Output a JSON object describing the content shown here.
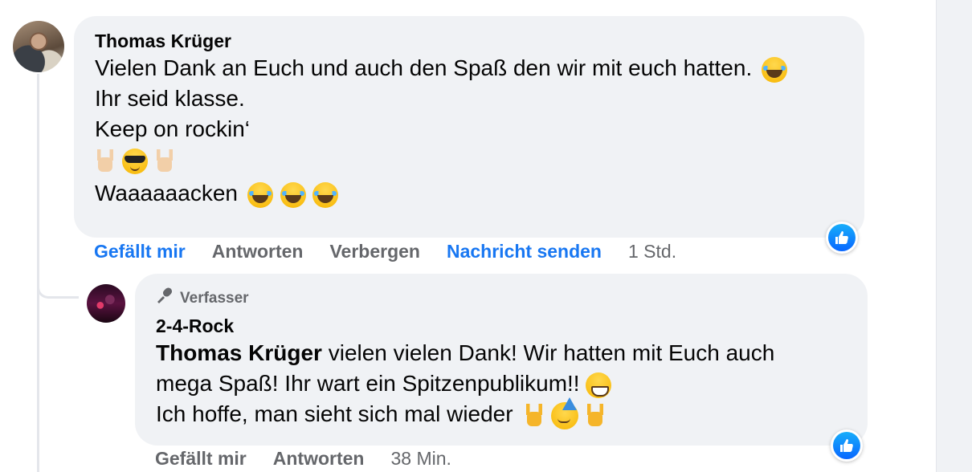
{
  "comment": {
    "author": "Thomas Krüger",
    "lines": [
      "Vielen Dank an Euch und auch den Spaß den wir mit euch hatten.",
      "Ihr seid klasse.",
      "Keep on rockin‘",
      "",
      "Waaaaaacken"
    ],
    "actions": {
      "like": "Gefällt mir",
      "reply": "Antworten",
      "hide": "Verbergen",
      "message": "Nachricht senden",
      "time": "1 Std."
    },
    "reaction": "like"
  },
  "reply": {
    "badge": "Verfasser",
    "author": "2-4-Rock",
    "mention": "Thomas Krüger",
    "line1_rest": " vielen vielen Dank! Wir hatten mit Euch auch",
    "line2": "mega Spaß! Ihr wart ein Spitzenpublikum!!",
    "line3": "Ich hoffe, man sieht sich mal wieder",
    "actions": {
      "like": "Gefällt mir",
      "reply": "Antworten",
      "time": "38 Min."
    },
    "reaction": "like"
  },
  "icons": {
    "like": "thumbs-up-icon",
    "author_badge": "microphone-icon"
  },
  "colors": {
    "link_blue": "#1877f2",
    "muted": "#65676b",
    "bubble": "#f0f2f5",
    "like_gradient_top": "#18aefa",
    "like_gradient_bottom": "#0866ff"
  }
}
